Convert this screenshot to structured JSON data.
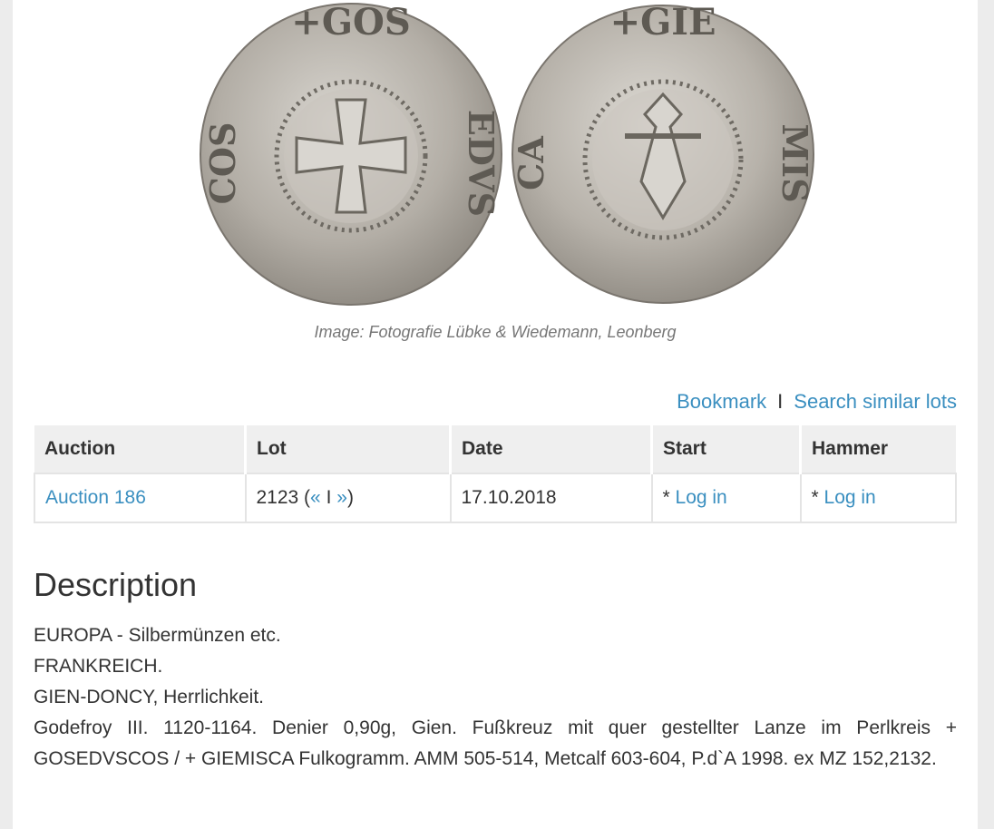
{
  "image": {
    "caption": "Image: Fotografie Lübke & Wiedemann, Leonberg",
    "coin_obverse_icon": "coin-obverse-cross",
    "coin_reverse_icon": "coin-reverse-fulcogram"
  },
  "actions": {
    "bookmark": "Bookmark",
    "separator": "I",
    "search_similar": "Search similar lots"
  },
  "table": {
    "headers": [
      "Auction",
      "Lot",
      "Date",
      "Start",
      "Hammer"
    ],
    "row": {
      "auction": "Auction 186",
      "lot_number": "2123",
      "lot_open": " (",
      "prev": "«",
      "lot_sep": " I ",
      "next": "»",
      "lot_close": ")",
      "date": "17.10.2018",
      "start_prefix": "* ",
      "start_link": "Log in",
      "hammer_prefix": "* ",
      "hammer_link": "Log in"
    }
  },
  "description": {
    "title": "Description",
    "lines": [
      "EUROPA - Silbermünzen etc.",
      "FRANKREICH.",
      "GIEN-DONCY, Herrlichkeit.",
      "Godefroy III. 1120-1164. Denier 0,90g, Gien. Fußkreuz mit quer gestellter Lanze im Perlkreis + GOSEDVSCOS / + GIEMISCA Fulkogramm. AMM 505-514, Metcalf 603-604, P.d`A 1998. ex MZ 152,2132."
    ]
  },
  "colors": {
    "link": "#3a8fc0",
    "header_bg": "#efefef",
    "page_bg": "#ececec",
    "coin_silver": "#b9b5ae"
  }
}
